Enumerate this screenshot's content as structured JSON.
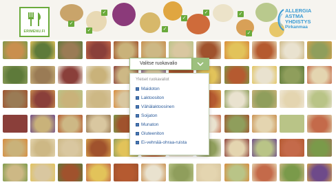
{
  "logo": {
    "text": "ERIMENU.FI",
    "icon": "fork-knife-icon"
  },
  "brand": {
    "line1": "ALLERGIA",
    "line2": "ASTMA",
    "line3": "YHDISTYS",
    "line4": "Pirkanmaa"
  },
  "colors": {
    "accent_green": "#6aaa3b",
    "brand_blue": "#3a9bd4",
    "link_blue": "#2a5a9a"
  },
  "menu": {
    "select_label": "Valitse ruokavalio",
    "dropdown_header": "Yleiset ruokavaliot",
    "options": [
      "Maidoton",
      "Laktoositon",
      "Vähälaktoosinen",
      "Soijaton",
      "Munaton",
      "Gluteeniton",
      "Ei-vehnää-ohraa-ruista"
    ]
  }
}
